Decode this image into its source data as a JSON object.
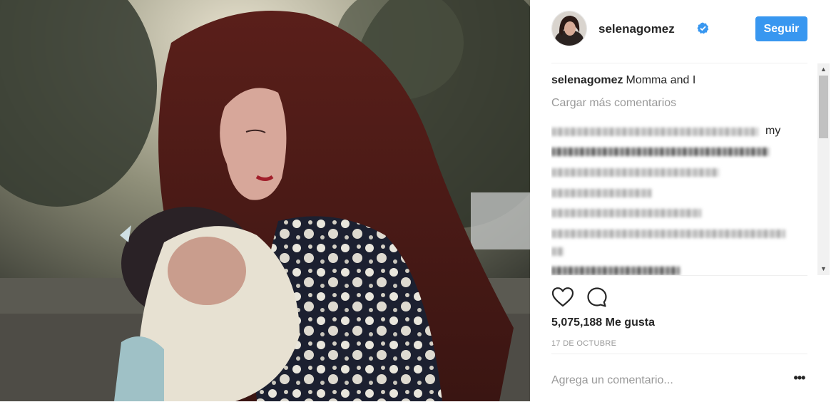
{
  "post": {
    "photo_alt": "Momma and I photo",
    "author": {
      "username": "selenagomez",
      "verified": true,
      "avatar_icon": "avatar"
    },
    "follow_label": "Seguir",
    "caption": {
      "username": "selenagomez",
      "text": "Momma and I"
    },
    "load_more_label": "Cargar más comentarios",
    "blurred_comments": [
      {
        "visible_tail": "my"
      },
      {
        "visible_tail": ""
      },
      {
        "visible_tail": ""
      },
      {
        "visible_tail": ""
      },
      {
        "visible_tail": ""
      },
      {
        "visible_tail": ""
      },
      {
        "visible_tail": ""
      }
    ],
    "actions": {
      "like_icon": "heart-icon",
      "comment_icon": "comment-bubble-icon"
    },
    "likes_text": "5,075,188 Me gusta",
    "date_text": "17 DE OCTUBRE",
    "add_comment_placeholder": "Agrega un comentario...",
    "more_options_label": "•••"
  },
  "colors": {
    "accent": "#3897f0",
    "text": "#262626",
    "muted": "#999999",
    "divider": "#efefef"
  }
}
